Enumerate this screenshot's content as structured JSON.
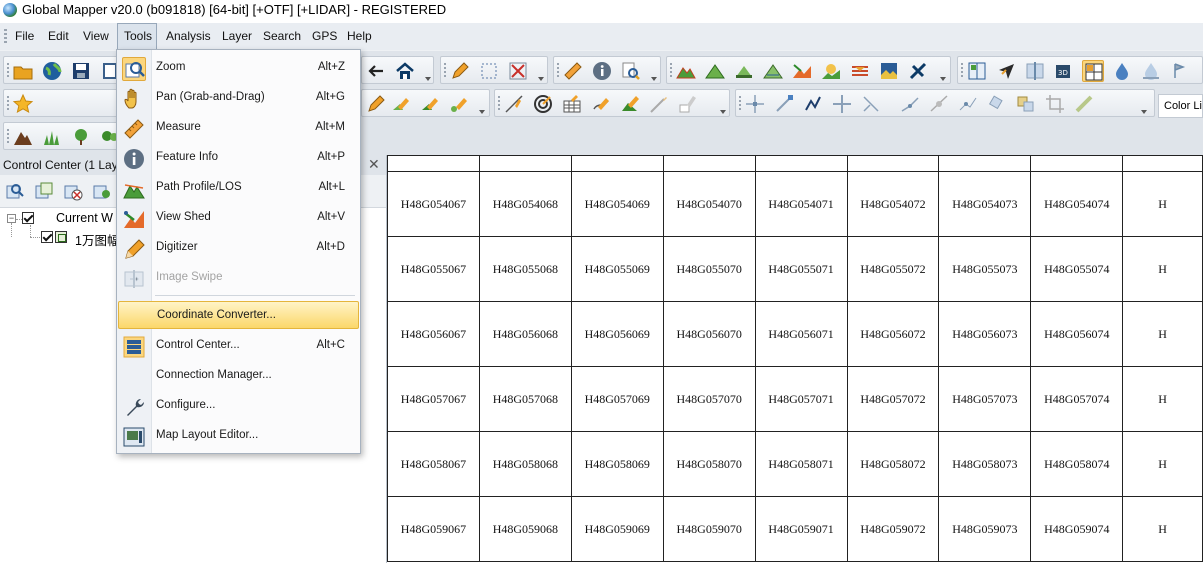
{
  "window": {
    "title": "Global Mapper v20.0 (b091818) [64-bit] [+OTF] [+LIDAR] - REGISTERED"
  },
  "menubar": {
    "items": [
      {
        "label": "File"
      },
      {
        "label": "Edit"
      },
      {
        "label": "View"
      },
      {
        "label": "Tools"
      },
      {
        "label": "Analysis"
      },
      {
        "label": "Layer"
      },
      {
        "label": "Search"
      },
      {
        "label": "GPS"
      },
      {
        "label": "Help"
      }
    ],
    "active": "Tools"
  },
  "toolbar": {
    "color_label": "Color Li"
  },
  "control_center": {
    "title": "Control Center (1 Laye",
    "close_glyph": "✕",
    "tree": {
      "root_label": "Current W",
      "layer_label": "1万图幅"
    }
  },
  "tools_menu": {
    "items": [
      {
        "label": "Zoom",
        "shortcut": "Alt+Z",
        "icon": "zoom-icon",
        "enabled": true
      },
      {
        "label": "Pan (Grab-and-Drag)",
        "shortcut": "Alt+G",
        "icon": "pan-hand-icon",
        "enabled": true
      },
      {
        "label": "Measure",
        "shortcut": "Alt+M",
        "icon": "measure-ruler-icon",
        "enabled": true
      },
      {
        "label": "Feature Info",
        "shortcut": "Alt+P",
        "icon": "info-icon",
        "enabled": true
      },
      {
        "label": "Path Profile/LOS",
        "shortcut": "Alt+L",
        "icon": "path-profile-icon",
        "enabled": true
      },
      {
        "label": "View Shed",
        "shortcut": "Alt+V",
        "icon": "view-shed-icon",
        "enabled": true
      },
      {
        "label": "Digitizer",
        "shortcut": "Alt+D",
        "icon": "digitizer-pencil-icon",
        "enabled": true
      },
      {
        "label": "Image Swipe",
        "shortcut": "",
        "icon": "image-swipe-icon",
        "enabled": false
      },
      {
        "label": "Coordinate Converter...",
        "shortcut": "",
        "icon": "",
        "enabled": true,
        "highlighted": true
      },
      {
        "label": "Control Center...",
        "shortcut": "Alt+C",
        "icon": "control-center-icon",
        "enabled": true
      },
      {
        "label": "Connection Manager...",
        "shortcut": "",
        "icon": "",
        "enabled": true
      },
      {
        "label": "Configure...",
        "shortcut": "",
        "icon": "wrench-icon",
        "enabled": true
      },
      {
        "label": "Map Layout Editor...",
        "shortcut": "",
        "icon": "map-layout-icon",
        "enabled": true
      }
    ]
  },
  "grid": {
    "rows": [
      [
        "H48G054067",
        "H48G054068",
        "H48G054069",
        "H48G054070",
        "H48G054071",
        "H48G054072",
        "H48G054073",
        "H48G054074",
        "H"
      ],
      [
        "H48G055067",
        "H48G055068",
        "H48G055069",
        "H48G055070",
        "H48G055071",
        "H48G055072",
        "H48G055073",
        "H48G055074",
        "H"
      ],
      [
        "H48G056067",
        "H48G056068",
        "H48G056069",
        "H48G056070",
        "H48G056071",
        "H48G056072",
        "H48G056073",
        "H48G056074",
        "H"
      ],
      [
        "H48G057067",
        "H48G057068",
        "H48G057069",
        "H48G057070",
        "H48G057071",
        "H48G057072",
        "H48G057073",
        "H48G057074",
        "H"
      ],
      [
        "H48G058067",
        "H48G058068",
        "H48G058069",
        "H48G058070",
        "H48G058071",
        "H48G058072",
        "H48G058073",
        "H48G058074",
        "H"
      ],
      [
        "H48G059067",
        "H48G059068",
        "H48G059069",
        "H48G059070",
        "H48G059071",
        "H48G059072",
        "H48G059073",
        "H48G059074",
        "H"
      ]
    ]
  },
  "colors": {
    "menu_highlight": "#fbd76a",
    "toolbar_bg": "#dfe4ea"
  }
}
